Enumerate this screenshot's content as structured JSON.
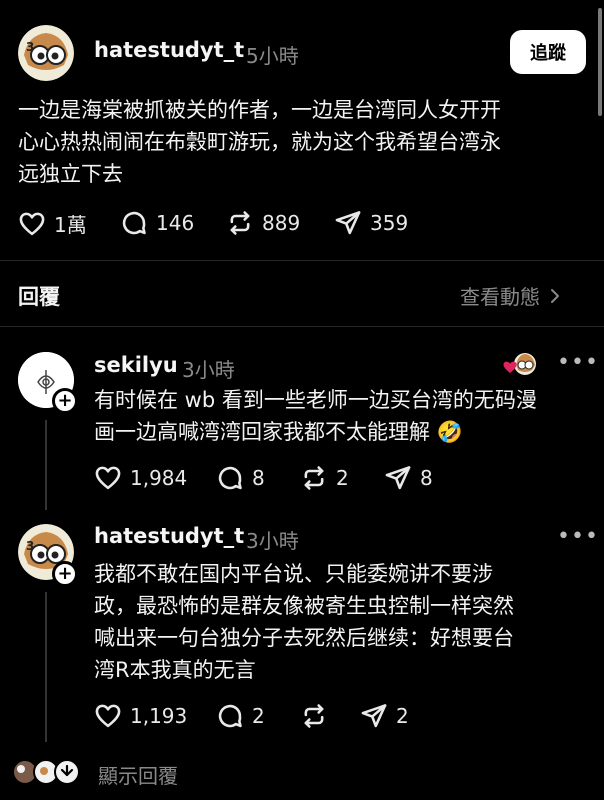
{
  "post": {
    "username": "hatestudyt_t",
    "time": "5小時",
    "follow_label": "追蹤",
    "text_lines": [
      "一边是海棠被抓被关的作者，一边是台湾同人女开开",
      "心心热热闹闹在布穀町游玩，就为这个我希望台湾永",
      "远独立下去"
    ],
    "likes": "1萬",
    "comments": "146",
    "reposts": "889",
    "shares": "359"
  },
  "replies_header": {
    "title": "回覆",
    "activity_label": "查看動態"
  },
  "reply1": {
    "username": "sekilyu",
    "time": "3小時",
    "text_lines": [
      "有时候在 wb 看到一些老师一边买台湾的无码漫",
      "画一边高喊湾湾回家我都不太能理解"
    ],
    "emoji": "🤣",
    "likes": "1,984",
    "comments": "8",
    "reposts": "2",
    "shares": "8"
  },
  "reply2": {
    "username": "hatestudyt_t",
    "time": "3小時",
    "text_lines": [
      "我都不敢在国内平台说、只能委婉讲不要涉",
      "政，最恐怖的是群友像被寄生虫控制一样突然",
      "喊出来一句台独分子去死然后继续：好想要台",
      "湾R本我真的无言"
    ],
    "likes": "1,193",
    "comments": "2",
    "reposts": "",
    "shares": "2"
  },
  "footer": {
    "show_replies_label": "顯示回覆"
  },
  "colors": {
    "background": "#000000",
    "text": "#f3f3f3",
    "muted": "#8a8a8a",
    "divider": "#262626",
    "like_heart": "#e0245e"
  },
  "icons": [
    "heart-icon",
    "comment-icon",
    "repost-icon",
    "share-icon",
    "chevron-right-icon",
    "more-icon",
    "plus-icon"
  ]
}
